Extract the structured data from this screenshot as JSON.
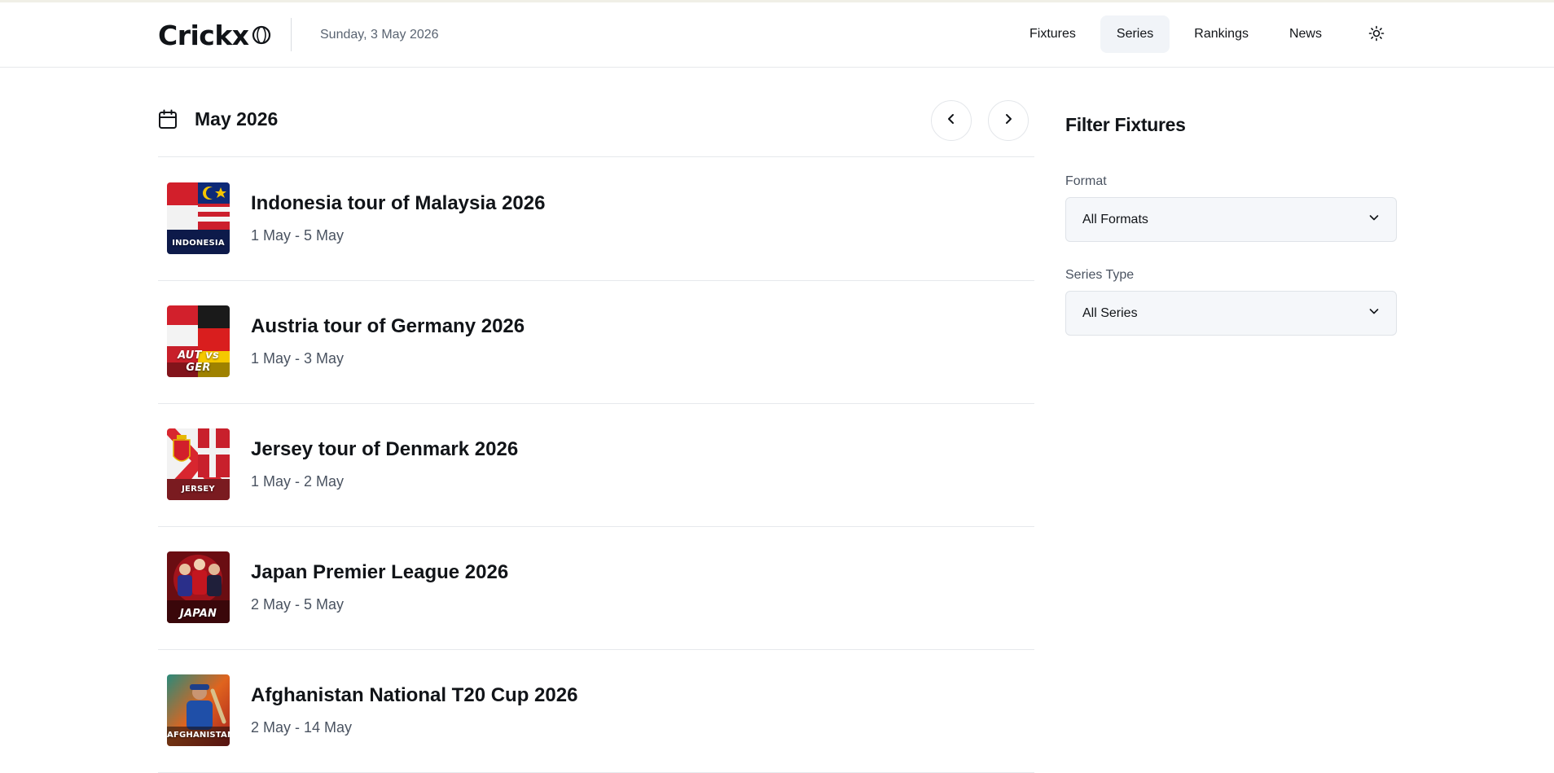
{
  "header": {
    "logo_text": "Crickx",
    "date": "Sunday, 3 May 2026",
    "nav": [
      {
        "label": "Fixtures",
        "active": false
      },
      {
        "label": "Series",
        "active": true
      },
      {
        "label": "Rankings",
        "active": false
      },
      {
        "label": "News",
        "active": false
      }
    ]
  },
  "calendar": {
    "month": "May 2026"
  },
  "series": [
    {
      "title": "Indonesia tour of Malaysia 2026",
      "dates": "1 May - 5 May",
      "thumb_label": "INDONESIA"
    },
    {
      "title": "Austria tour of Germany 2026",
      "dates": "1 May - 3 May",
      "thumb_label": "AUT vs GER"
    },
    {
      "title": "Jersey tour of Denmark 2026",
      "dates": "1 May - 2 May",
      "thumb_label": "JERSEY"
    },
    {
      "title": "Japan Premier League 2026",
      "dates": "2 May - 5 May",
      "thumb_label": "JAPAN"
    },
    {
      "title": "Afghanistan National T20 Cup 2026",
      "dates": "2 May - 14 May",
      "thumb_label": "AFGHANISTAN"
    }
  ],
  "filters": {
    "title": "Filter Fixtures",
    "format": {
      "label": "Format",
      "value": "All Formats"
    },
    "series_type": {
      "label": "Series Type",
      "value": "All Series"
    }
  },
  "colors": {
    "accent_bg": "#f1f4f8",
    "border": "#e6e8ec",
    "muted_text": "#4a5361"
  }
}
